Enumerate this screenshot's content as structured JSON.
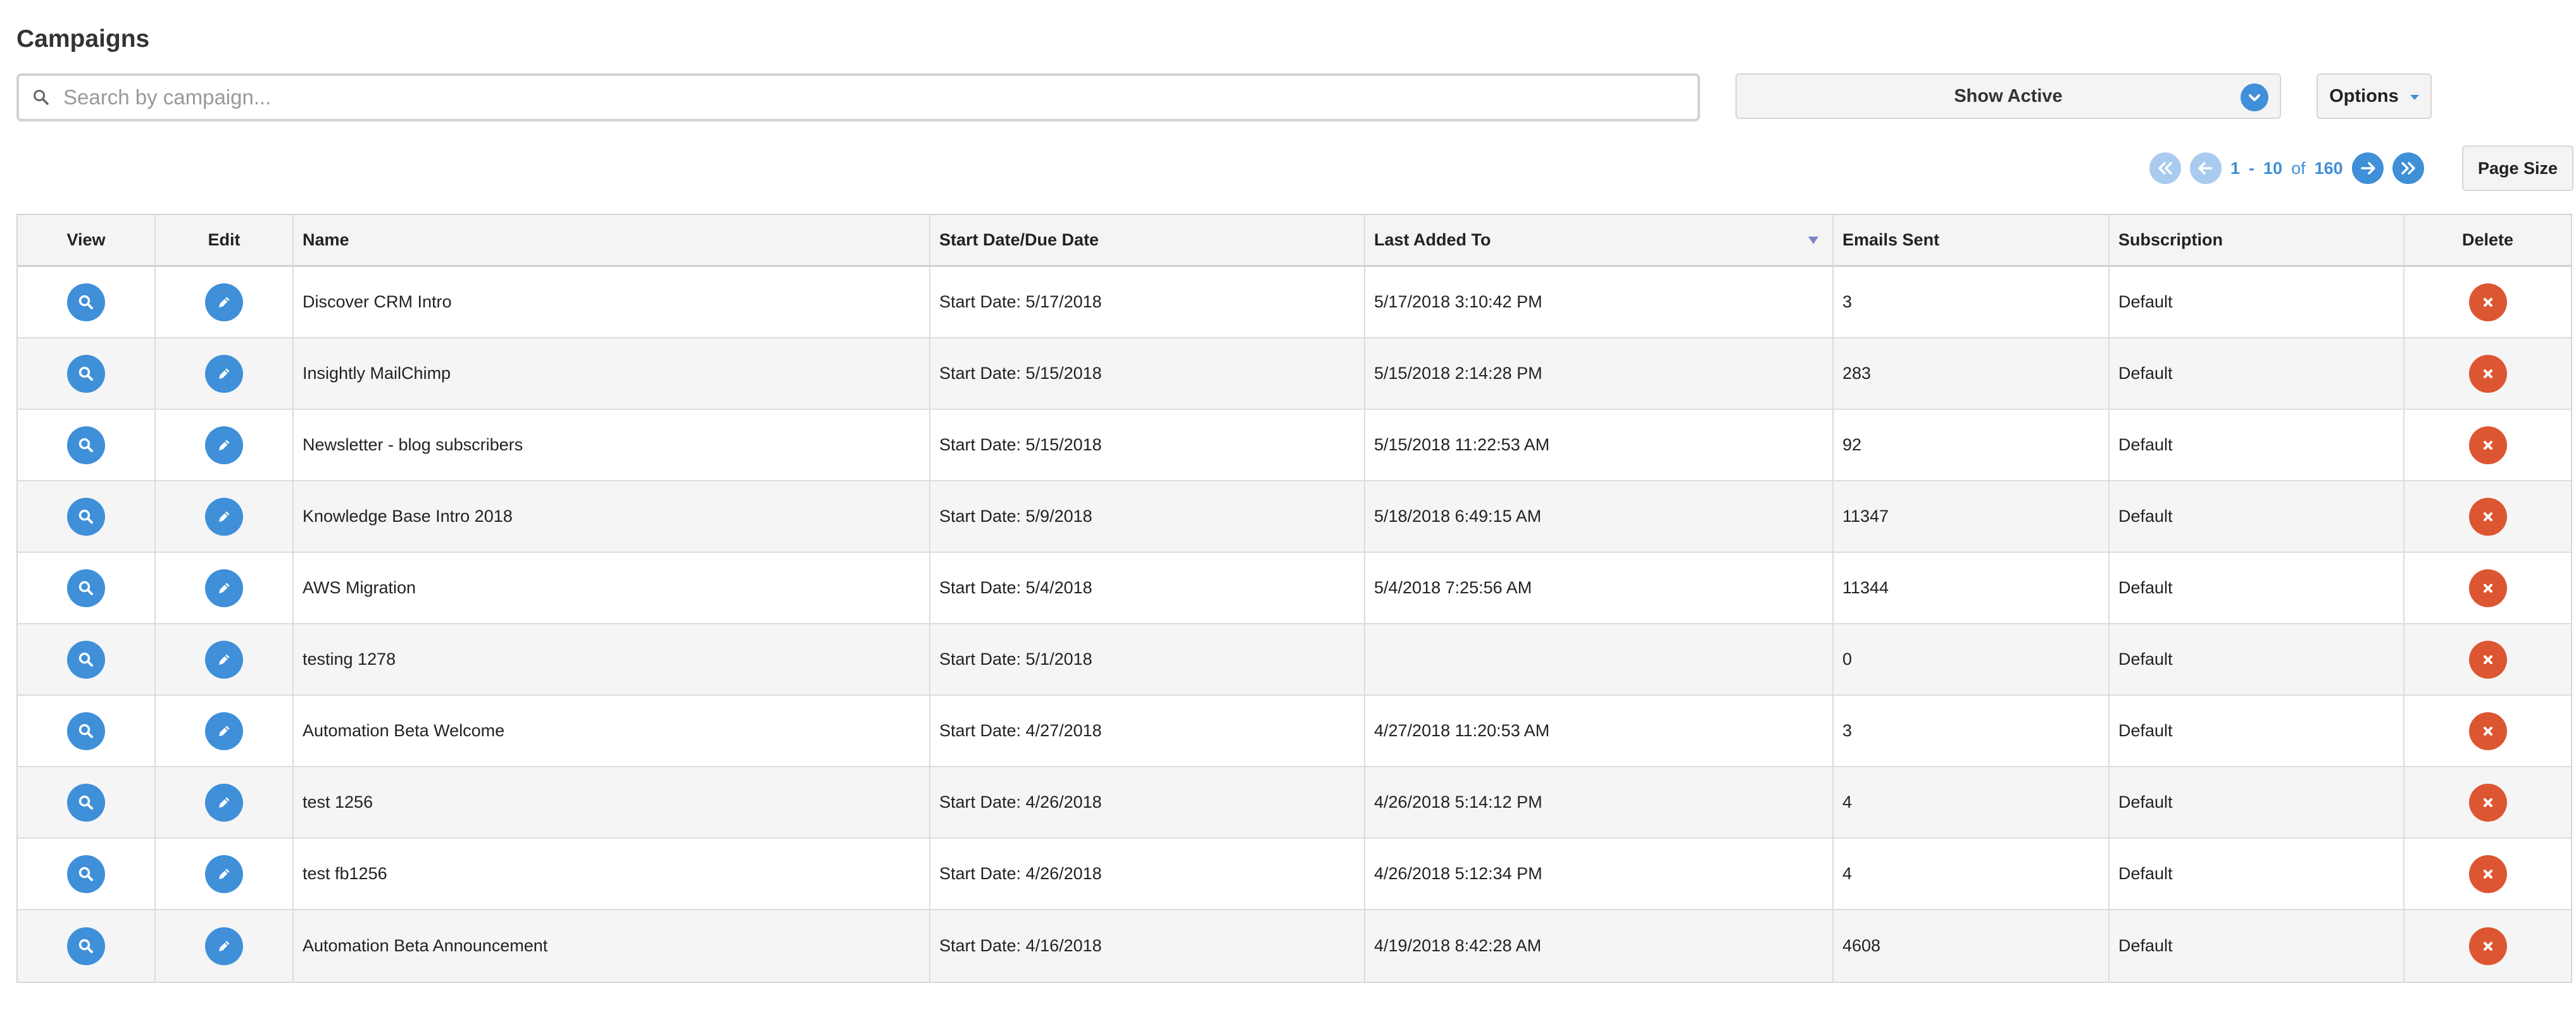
{
  "page": {
    "title": "Campaigns"
  },
  "search": {
    "placeholder": "Search by campaign..."
  },
  "filter": {
    "selected": "Show Active"
  },
  "options": {
    "label": "Options"
  },
  "pagination": {
    "start": "1",
    "separator": "-",
    "end": "10",
    "of_label": "of",
    "total": "160",
    "page_size_label": "Page Size"
  },
  "table": {
    "headers": {
      "view": "View",
      "edit": "Edit",
      "name": "Name",
      "start": "Start Date/Due Date",
      "last": "Last Added To",
      "emails": "Emails Sent",
      "subscription": "Subscription",
      "delete": "Delete"
    },
    "rows": [
      {
        "name": "Discover CRM Intro",
        "start": "Start Date: 5/17/2018",
        "last": "5/17/2018 3:10:42 PM",
        "emails": "3",
        "subscription": "Default"
      },
      {
        "name": "Insightly MailChimp",
        "start": "Start Date: 5/15/2018",
        "last": "5/15/2018 2:14:28 PM",
        "emails": "283",
        "subscription": "Default"
      },
      {
        "name": "Newsletter - blog subscribers",
        "start": "Start Date: 5/15/2018",
        "last": "5/15/2018 11:22:53 AM",
        "emails": "92",
        "subscription": "Default"
      },
      {
        "name": "Knowledge Base Intro 2018",
        "start": "Start Date: 5/9/2018",
        "last": "5/18/2018 6:49:15 AM",
        "emails": "11347",
        "subscription": "Default"
      },
      {
        "name": "AWS Migration",
        "start": "Start Date: 5/4/2018",
        "last": "5/4/2018 7:25:56 AM",
        "emails": "11344",
        "subscription": "Default"
      },
      {
        "name": "testing 1278",
        "start": "Start Date: 5/1/2018",
        "last": "",
        "emails": "0",
        "subscription": "Default"
      },
      {
        "name": "Automation Beta Welcome",
        "start": "Start Date: 4/27/2018",
        "last": "4/27/2018 11:20:53 AM",
        "emails": "3",
        "subscription": "Default"
      },
      {
        "name": "test 1256",
        "start": "Start Date: 4/26/2018",
        "last": "4/26/2018 5:14:12 PM",
        "emails": "4",
        "subscription": "Default"
      },
      {
        "name": "test fb1256",
        "start": "Start Date: 4/26/2018",
        "last": "4/26/2018 5:12:34 PM",
        "emails": "4",
        "subscription": "Default"
      },
      {
        "name": "Automation Beta Announcement",
        "start": "Start Date: 4/16/2018",
        "last": "4/19/2018 8:42:28 AM",
        "emails": "4608",
        "subscription": "Default"
      }
    ]
  },
  "icons": {
    "search": "search-icon",
    "dropdown": "chevron-down-icon",
    "view": "magnifier-icon",
    "edit": "pencil-icon",
    "delete": "close-icon",
    "first": "double-arrow-left-icon",
    "prev": "arrow-left-icon",
    "next": "arrow-right-icon",
    "last": "double-arrow-right-icon"
  },
  "colors": {
    "accent": "#3f8fd9",
    "danger": "#dd5632",
    "header_bg": "#f4f4f4"
  }
}
